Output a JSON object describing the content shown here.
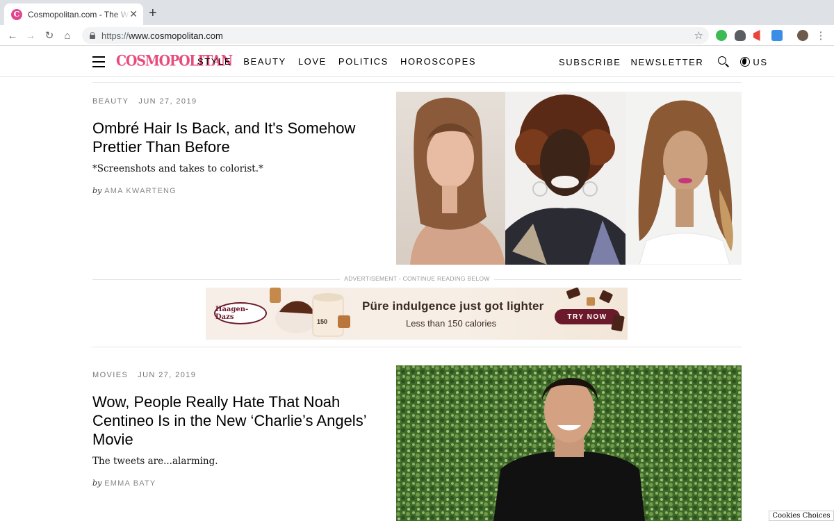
{
  "browser": {
    "tab_title": "Cosmopolitan.com - The Women's Magazine",
    "favicon_letter": "C",
    "url_scheme": "https://",
    "url_host": "www.cosmopolitan.com"
  },
  "header": {
    "logo": "COSMOPOLITAN",
    "nav": [
      "STYLE",
      "BEAUTY",
      "LOVE",
      "POLITICS",
      "HOROSCOPES"
    ],
    "subscribe": "SUBSCRIBE",
    "newsletter": "NEWSLETTER",
    "locale": "US"
  },
  "articles": [
    {
      "section": "BEAUTY",
      "date": "JUN 27, 2019",
      "title": "Ombré Hair Is Back, and It's Somehow Prettier Than Before",
      "dek": "*Screenshots and takes to colorist.*",
      "by_label": "by",
      "author": "AMA KWARTENG"
    },
    {
      "section": "MOVIES",
      "date": "JUN 27, 2019",
      "title": "Wow, People Really Hate That Noah Centineo Is in the New ‘Charlie’s Angels’ Movie",
      "dek": "The tweets are...alarming.",
      "by_label": "by",
      "author": "EMMA BATY"
    }
  ],
  "ad": {
    "label": "ADVERTISEMENT - CONTINUE READING BELOW",
    "brand": "Häagen-Dazs",
    "headline": "Püre indulgence just got lighter",
    "subline": "Less than 150 calories",
    "cta": "TRY NOW",
    "pint_calories": "150"
  },
  "cookies": "Cookies Choices",
  "colors": {
    "brand_pink": "#e84c7d",
    "ad_cta": "#6b1a2b",
    "hedge_green": "#3f6b2a"
  }
}
